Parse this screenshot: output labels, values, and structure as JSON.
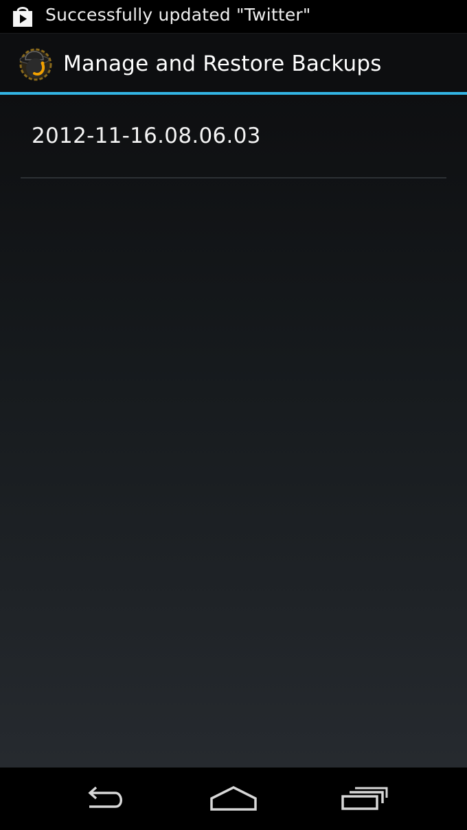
{
  "status_bar": {
    "notification_icon": "play-store-bag-icon",
    "notification_text": "Successfully updated \"Twitter\""
  },
  "action_bar": {
    "app_icon": "titanium-backup-icon",
    "title": "Manage and Restore Backups",
    "accent_color": "#33b5e5"
  },
  "backups": {
    "items": [
      {
        "label": "2012-11-16.08.06.03"
      }
    ]
  },
  "nav_bar": {
    "back_icon": "back-icon",
    "home_icon": "home-icon",
    "recents_icon": "recent-apps-icon"
  }
}
